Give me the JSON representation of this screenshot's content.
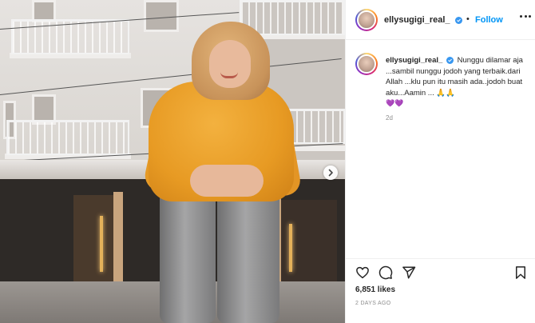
{
  "post": {
    "username": "ellysugigi_real_",
    "follow_label": "Follow",
    "separator": "•",
    "caption_text": "Nunggu dilamar aja ...sambil nunggu jodoh yang terbaik.dari Allah ...klu pun itu masih ada..jodoh buat aku...Aamin ...",
    "caption_emoji": "🙏🙏",
    "caption_hearts": "💜💜",
    "relative_time": "2d",
    "likes_text": "6,851 likes",
    "date_text": "2 DAYS AGO"
  },
  "icons": {
    "verified": "verified-badge-icon",
    "more": "more-options-icon",
    "like": "heart-icon",
    "comment": "comment-icon",
    "share": "paper-plane-icon",
    "save": "bookmark-icon",
    "next": "chevron-right-icon"
  },
  "colors": {
    "accent": "#0095f6",
    "verified": "#3897f0",
    "text": "#262626",
    "muted": "#8e8e8e",
    "sweater": "#e89b24"
  }
}
